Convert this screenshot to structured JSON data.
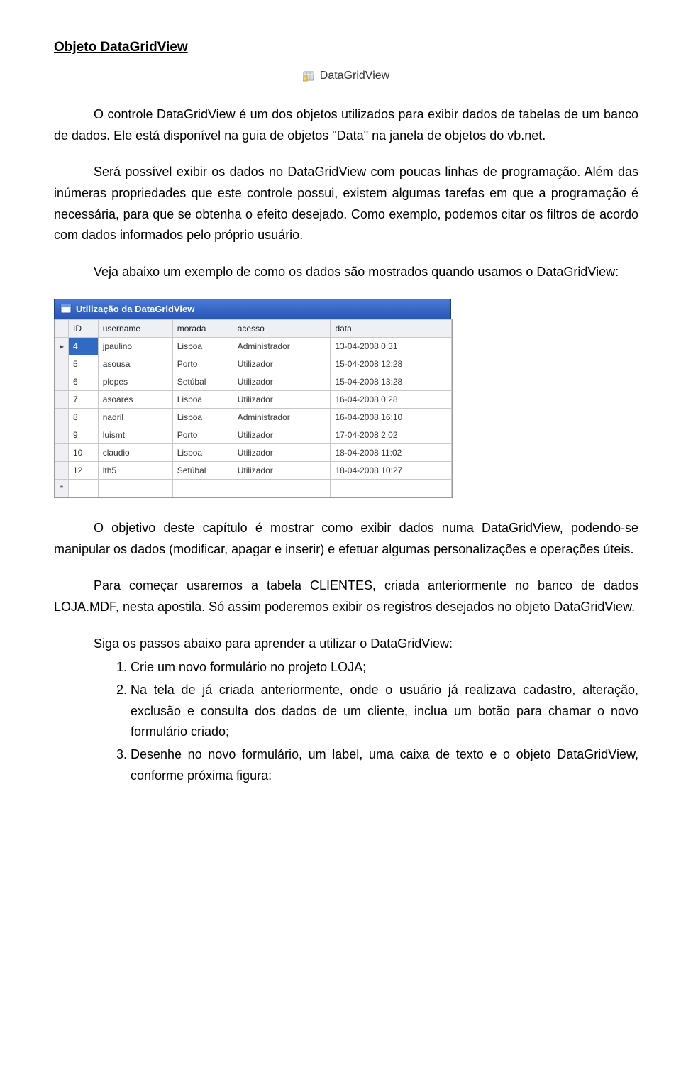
{
  "title": "Objeto DataGridView",
  "hero": {
    "label": "DataGridView"
  },
  "paragraphs": {
    "p1": "O controle DataGridView é um dos objetos utilizados para exibir dados de tabelas de um banco de dados. Ele está disponível na guia de objetos \"Data\" na janela de objetos do vb.net.",
    "p2": "Será possível exibir os dados no DataGridView com poucas linhas de programação. Além das inúmeras propriedades que este controle possui, existem algumas tarefas em que a programação é necessária, para que se obtenha o efeito desejado. Como exemplo, podemos citar os filtros de acordo com dados informados pelo próprio usuário.",
    "p3": "Veja abaixo um exemplo de como os dados são mostrados quando usamos o DataGridView:",
    "p4": "O objetivo deste capítulo é mostrar como exibir dados numa DataGridView, podendo-se manipular os dados (modificar, apagar e inserir) e efetuar algumas personalizações e operações úteis.",
    "p5": "Para começar usaremos a tabela CLIENTES, criada anteriormente no banco de dados LOJA.MDF, nesta apostila. Só assim poderemos exibir os registros desejados no objeto DataGridView.",
    "stepsIntro": "Siga os passos abaixo para aprender a utilizar o DataGridView:",
    "step1": "Crie um novo formulário no projeto LOJA;",
    "step2": "Na tela de já criada anteriormente, onde o usuário já realizava cadastro, alteração, exclusão e consulta dos dados de um cliente, inclua um botão para chamar o novo formulário criado;",
    "step3": "Desenhe no novo formulário, um label, uma caixa de texto e o objeto DataGridView, conforme próxima figura:"
  },
  "window": {
    "title": "Utilização da DataGridView"
  },
  "grid": {
    "columns": [
      "ID",
      "username",
      "morada",
      "acesso",
      "data"
    ],
    "rows": [
      {
        "sel": true,
        "cells": [
          "4",
          "jpaulino",
          "Lisboa",
          "Administrador",
          "13-04-2008 0:31"
        ]
      },
      {
        "sel": false,
        "cells": [
          "5",
          "asousa",
          "Porto",
          "Utilizador",
          "15-04-2008 12:28"
        ]
      },
      {
        "sel": false,
        "cells": [
          "6",
          "plopes",
          "Setúbal",
          "Utilizador",
          "15-04-2008 13:28"
        ]
      },
      {
        "sel": false,
        "cells": [
          "7",
          "asoares",
          "Lisboa",
          "Utilizador",
          "16-04-2008 0:28"
        ]
      },
      {
        "sel": false,
        "cells": [
          "8",
          "nadril",
          "Lisboa",
          "Administrador",
          "16-04-2008 16:10"
        ]
      },
      {
        "sel": false,
        "cells": [
          "9",
          "luismt",
          "Porto",
          "Utilizador",
          "17-04-2008 2:02"
        ]
      },
      {
        "sel": false,
        "cells": [
          "10",
          "claudio",
          "Lisboa",
          "Utilizador",
          "18-04-2008 11:02"
        ]
      },
      {
        "sel": false,
        "cells": [
          "12",
          "lth5",
          "Setúbal",
          "Utilizador",
          "18-04-2008 10:27"
        ]
      }
    ],
    "rowMarker": "▸",
    "newRowMarker": "*"
  }
}
